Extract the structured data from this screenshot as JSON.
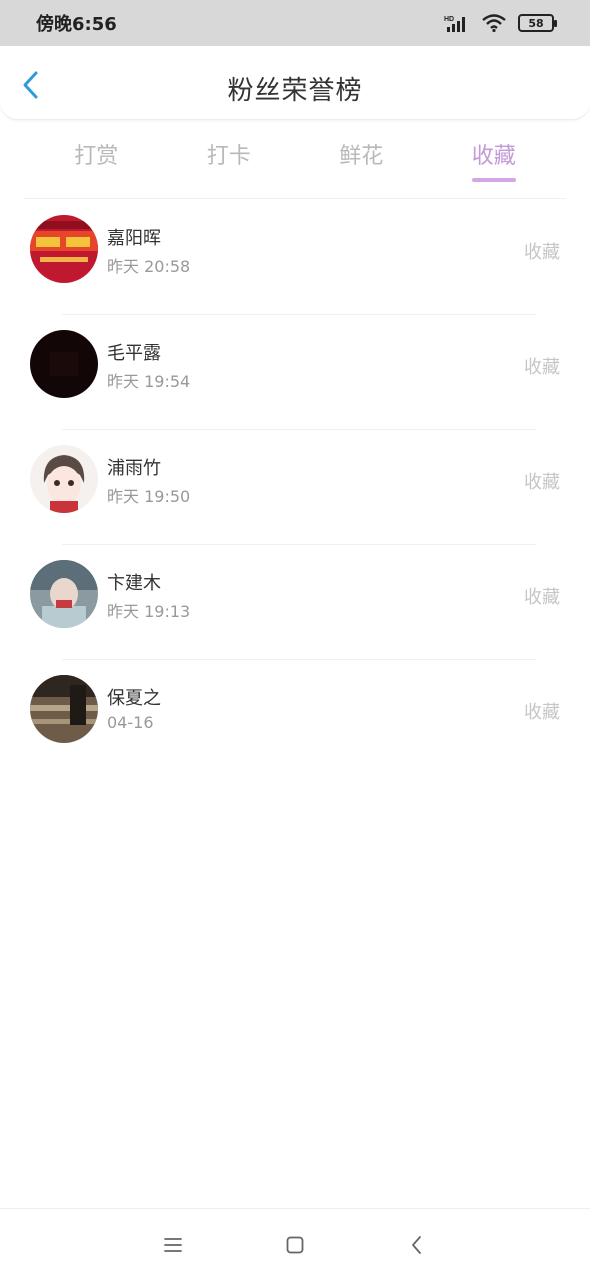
{
  "status": {
    "time": "傍晚6:56",
    "network": "HD",
    "battery": "58"
  },
  "header": {
    "title": "粉丝荣誉榜",
    "back_icon": "chevron-left-icon"
  },
  "tabs": [
    {
      "label": "打赏",
      "active": false
    },
    {
      "label": "打卡",
      "active": false
    },
    {
      "label": "鲜花",
      "active": false
    },
    {
      "label": "收藏",
      "active": true
    }
  ],
  "list": [
    {
      "name": "嘉阳晖",
      "time": "昨天 20:58",
      "action": "收藏"
    },
    {
      "name": "毛平露",
      "time": "昨天 19:54",
      "action": "收藏"
    },
    {
      "name": "浦雨竹",
      "time": "昨天 19:50",
      "action": "收藏"
    },
    {
      "name": "卞建木",
      "time": "昨天 19:13",
      "action": "收藏"
    },
    {
      "name": "保夏之",
      "time": "04-16",
      "action": "收藏"
    }
  ],
  "colors": {
    "accent": "#c49ad6",
    "back": "#2f9bd9"
  }
}
